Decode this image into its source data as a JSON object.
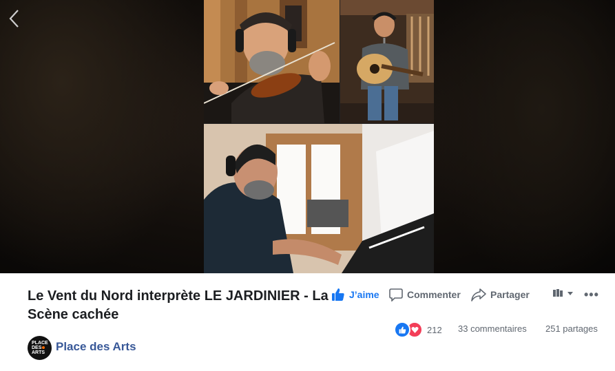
{
  "viewer": {
    "back_icon": "chevron-left-icon",
    "video_tiles": [
      "violinist",
      "guitarist",
      "pianist"
    ]
  },
  "post": {
    "title": "Le Vent du Nord interprète LE JARDINIER - La Scène cachée",
    "actions": {
      "like_label": "J’aime",
      "comment_label": "Commenter",
      "share_label": "Partager"
    },
    "audience_icon": "public-audience-icon",
    "more_icon": "more-horizontal-icon",
    "more_label": "•••",
    "reactions": {
      "types": [
        "like",
        "love"
      ],
      "count": "212"
    },
    "comments_count": "33 commentaires",
    "shares_count": "251 partages",
    "page": {
      "name": "Place des Arts",
      "avatar_text": [
        "PLACE",
        "DES",
        "ARTS"
      ]
    }
  },
  "colors": {
    "accent": "#1877f2",
    "page_link": "#385898",
    "love": "#f33e58",
    "muted_text": "#606770"
  }
}
